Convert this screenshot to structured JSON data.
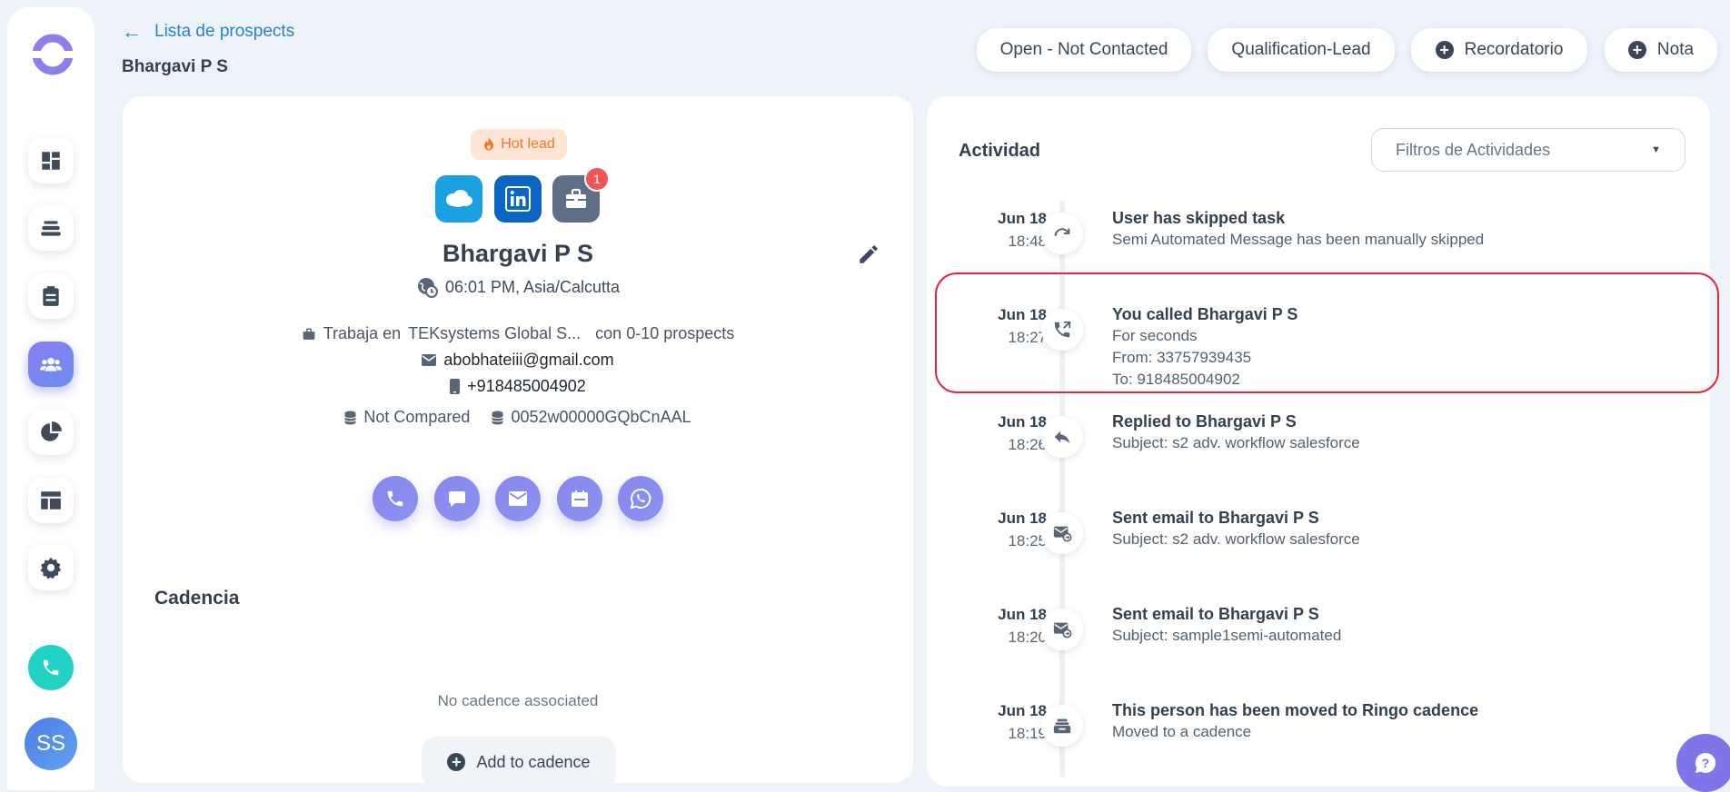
{
  "header": {
    "back_label": "Lista de prospects",
    "title": "Bhargavi P S",
    "buttons": {
      "status": "Open - Not Contacted",
      "stage": "Qualification-Lead",
      "reminder": "Recordatorio",
      "note": "Nota"
    }
  },
  "sidebar": {
    "items": [
      "dashboard-icon",
      "layers-icon",
      "clipboard-icon",
      "people-icon",
      "pie-chart-icon",
      "layout-icon",
      "gear-icon"
    ],
    "active_item": "people-icon",
    "avatar_initials": "SS"
  },
  "prospect": {
    "hot_lead": "Hot lead",
    "notification_count": "1",
    "name": "Bhargavi P S",
    "timezone": "06:01 PM, Asia/Calcutta",
    "works_at_prefix": "Trabaja en",
    "company": "TEKsystems Global S...",
    "company_suffix": "con 0-10 prospects",
    "email": "abobhateiii@gmail.com",
    "phone": "+918485004902",
    "compare_status": "Not Compared",
    "salesforce_id": "0052w00000GQbCnAAL"
  },
  "cadence": {
    "title": "Cadencia",
    "empty": "No cadence associated",
    "add_label": "Add to cadence"
  },
  "activity": {
    "title": "Actividad",
    "filter_placeholder": "Filtros de Actividades",
    "items": [
      {
        "date": "Jun 18",
        "time": "18:48",
        "icon": "skip-icon",
        "head": "User has skipped task",
        "lines": [
          "Semi Automated Message has been manually skipped"
        ]
      },
      {
        "date": "Jun 18",
        "time": "18:27",
        "icon": "call-out-icon",
        "head": "You called Bhargavi P S",
        "lines": [
          "For seconds",
          "From: 33757939435",
          "To: 918485004902"
        ]
      },
      {
        "date": "Jun 18",
        "time": "18:26",
        "icon": "reply-icon",
        "head": "Replied to Bhargavi P S",
        "lines": [
          "Subject: s2 adv. workflow salesforce"
        ]
      },
      {
        "date": "Jun 18",
        "time": "18:25",
        "icon": "email-sent-icon",
        "head": "Sent email to Bhargavi P S",
        "lines": [
          "Subject: s2 adv. workflow salesforce"
        ]
      },
      {
        "date": "Jun 18",
        "time": "18:20",
        "icon": "email-sent-icon",
        "head": "Sent email to Bhargavi P S",
        "lines": [
          "Subject: sample1semi-automated"
        ]
      },
      {
        "date": "Jun 18",
        "time": "18:19",
        "icon": "cadence-move-icon",
        "head": "This person has been moved to Ringo cadence",
        "lines": [
          "Moved to a cadence"
        ]
      }
    ]
  },
  "colors": {
    "accent": "#2a7fd8",
    "action_purple": "#8a86ee",
    "call_teal": "#22d2c4",
    "highlight_red": "#e02a3c",
    "hot_lead_bg": "#fde7d4"
  }
}
